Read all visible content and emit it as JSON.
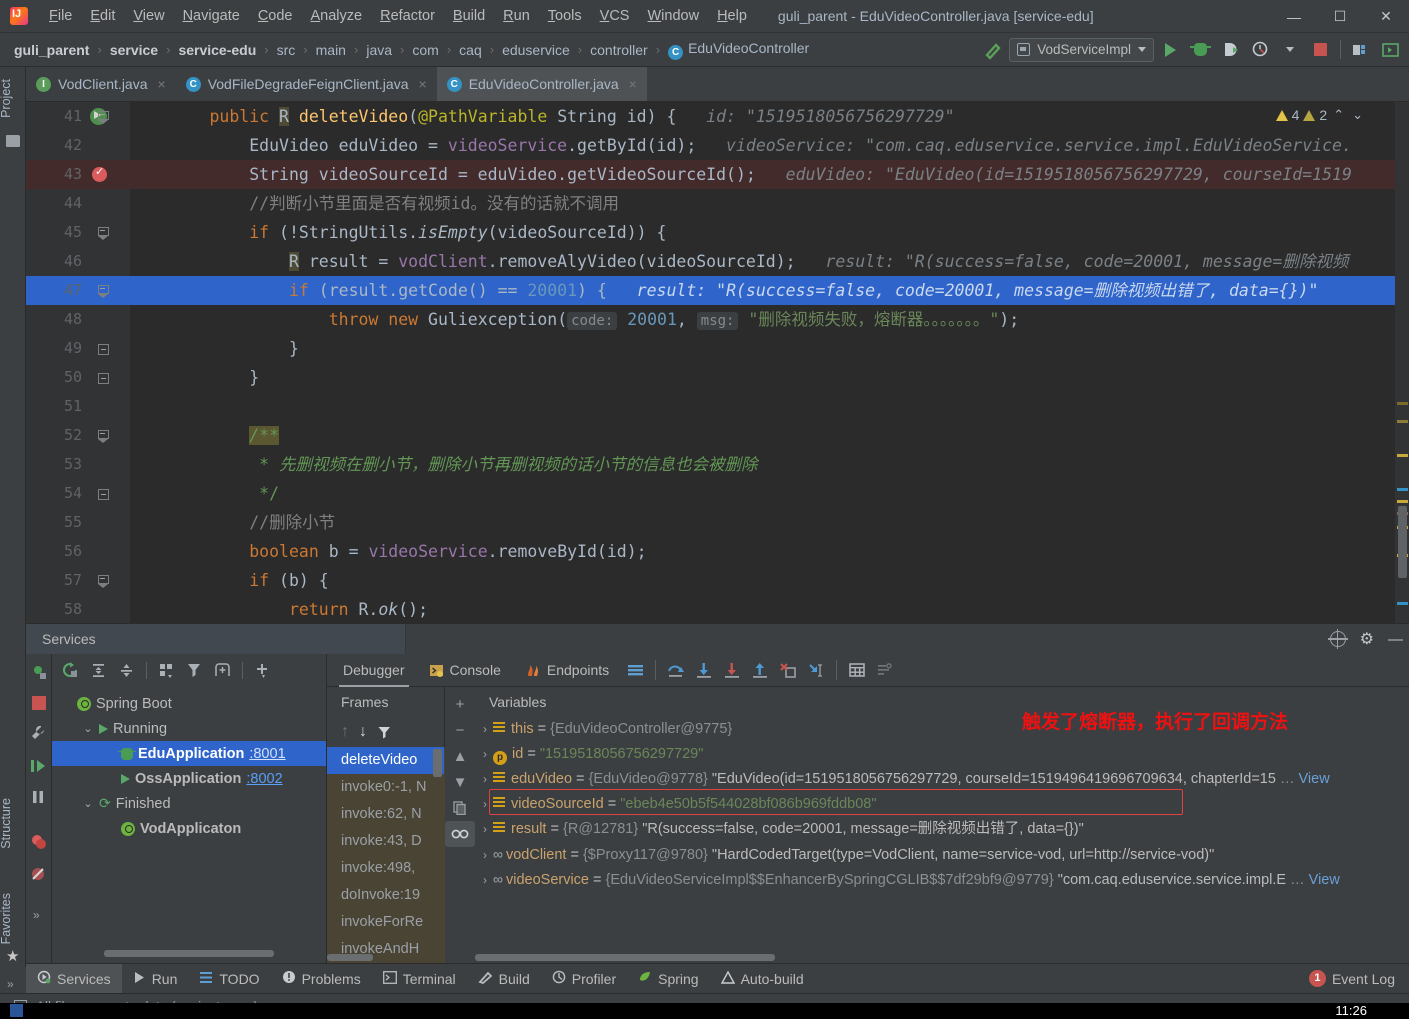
{
  "window": {
    "title": "guli_parent - EduVideoController.java [service-edu]",
    "minimize": "—",
    "maximize": "☐",
    "close": "✕"
  },
  "menu": [
    "File",
    "Edit",
    "View",
    "Navigate",
    "Code",
    "Analyze",
    "Refactor",
    "Build",
    "Run",
    "Tools",
    "VCS",
    "Window",
    "Help"
  ],
  "breadcrumb": {
    "items": [
      {
        "label": "guli_parent",
        "bold": true
      },
      {
        "label": "service",
        "bold": true
      },
      {
        "label": "service-edu",
        "bold": true
      },
      {
        "label": "src",
        "bold": false
      },
      {
        "label": "main",
        "bold": false
      },
      {
        "label": "java",
        "bold": false
      },
      {
        "label": "com",
        "bold": false
      },
      {
        "label": "caq",
        "bold": false
      },
      {
        "label": "eduservice",
        "bold": false
      },
      {
        "label": "controller",
        "bold": false
      },
      {
        "label": "EduVideoController",
        "bold": false,
        "icon": "C"
      }
    ],
    "separator": "›"
  },
  "toolbar": {
    "run_config": "VodServiceImpl",
    "icons": [
      "hammer-build-icon",
      "run-icon",
      "debug-icon",
      "run-with-coverage-icon",
      "profiler-icon",
      "stop-icon",
      "project-structure-icon",
      "search-everywhere-icon"
    ]
  },
  "tabs": [
    {
      "label": "VodClient.java",
      "icon": "I",
      "kind": "iface",
      "active": false
    },
    {
      "label": "VodFileDegradeFeignClient.java",
      "icon": "C",
      "kind": "cls",
      "active": false
    },
    {
      "label": "EduVideoController.java",
      "icon": "C",
      "kind": "cls",
      "active": true
    }
  ],
  "left_strip": {
    "project": "Project",
    "structure": "Structure",
    "favorites": "Favorites"
  },
  "editor": {
    "warnings": {
      "error_count": "4",
      "warn_count": "2",
      "up": "⌃",
      "down": "⌄"
    },
    "lines": [
      {
        "n": "41",
        "marker": "run",
        "fold": "collapse",
        "tokens": [
          {
            "t": "        ",
            "c": "pln"
          },
          {
            "t": "public",
            "c": "kw"
          },
          {
            "t": " ",
            "c": "pln"
          },
          {
            "t": "R",
            "c": "staticvar"
          },
          {
            "t": " ",
            "c": "pln"
          },
          {
            "t": "deleteVideo",
            "c": "fn"
          },
          {
            "t": "(",
            "c": "pln"
          },
          {
            "t": "@PathVariable",
            "c": "ann"
          },
          {
            "t": " String id) {",
            "c": "pln"
          }
        ],
        "hint": "id: \"1519518056756297729\""
      },
      {
        "n": "42",
        "marker": "",
        "fold": "",
        "tokens": [
          {
            "t": "            EduVideo eduVideo = ",
            "c": "pln"
          },
          {
            "t": "videoService",
            "c": "fld"
          },
          {
            "t": ".getById(id);",
            "c": "pln"
          }
        ],
        "hint": "videoService: \"com.caq.eduservice.service.impl.EduVideoService."
      },
      {
        "n": "43",
        "marker": "breakpoint",
        "fold": "",
        "hl": "red",
        "tokens": [
          {
            "t": "            String videoSourceId = eduVideo.getVideoSourceId();",
            "c": "pln"
          }
        ],
        "hint": "eduVideo: \"EduVideo(id=1519518056756297729, courseId=1519"
      },
      {
        "n": "44",
        "marker": "",
        "fold": "",
        "tokens": [
          {
            "t": "            //判断小节里面是否有视频id。没有的话就不调用",
            "c": "cmt"
          }
        ],
        "hint": ""
      },
      {
        "n": "45",
        "marker": "",
        "fold": "collapse",
        "tokens": [
          {
            "t": "            ",
            "c": "pln"
          },
          {
            "t": "if",
            "c": "kw"
          },
          {
            "t": " (!StringUtils.",
            "c": "pln"
          },
          {
            "t": "isEmpty",
            "c": "pln ital"
          },
          {
            "t": "(videoSourceId)) {",
            "c": "pln"
          }
        ],
        "hint": ""
      },
      {
        "n": "46",
        "marker": "",
        "fold": "",
        "tokens": [
          {
            "t": "                ",
            "c": "pln"
          },
          {
            "t": "R",
            "c": "staticvar"
          },
          {
            "t": " result = ",
            "c": "pln"
          },
          {
            "t": "vodClient",
            "c": "fld"
          },
          {
            "t": ".removeAlyVideo(videoSourceId);",
            "c": "pln"
          }
        ],
        "hint": "result: \"R(success=false, code=20001, message=删除视频"
      },
      {
        "n": "47",
        "marker": "",
        "fold": "collapse",
        "hl": "blue",
        "tokens": [
          {
            "t": "                ",
            "c": "pln"
          },
          {
            "t": "if",
            "c": "kw"
          },
          {
            "t": " (result.getCode() == ",
            "c": "pln"
          },
          {
            "t": "20001",
            "c": "num"
          },
          {
            "t": ") {",
            "c": "pln"
          }
        ],
        "hint": "result: \"R(success=false, code=20001, message=删除视频出错了, data={})\""
      },
      {
        "n": "48",
        "marker": "",
        "fold": "",
        "tokens": [
          {
            "t": "                    ",
            "c": "pln"
          },
          {
            "t": "throw",
            "c": "kw"
          },
          {
            "t": " ",
            "c": "pln"
          },
          {
            "t": "new",
            "c": "kw"
          },
          {
            "t": " ",
            "c": "pln"
          },
          {
            "t": "Guliexception",
            "c": "pln"
          },
          {
            "t": "(",
            "c": "pln"
          },
          {
            "t": "code:",
            "c": "param"
          },
          {
            "t": " ",
            "c": "pln"
          },
          {
            "t": "20001",
            "c": "num"
          },
          {
            "t": ", ",
            "c": "pln"
          },
          {
            "t": "msg:",
            "c": "param"
          },
          {
            "t": " ",
            "c": "pln"
          },
          {
            "t": "\"删除视频失败，熔断器。。。。。。。\"",
            "c": "str"
          },
          {
            "t": ");",
            "c": "pln"
          }
        ],
        "hint": ""
      },
      {
        "n": "49",
        "marker": "",
        "fold": "marker",
        "tokens": [
          {
            "t": "                }",
            "c": "pln"
          }
        ],
        "hint": ""
      },
      {
        "n": "50",
        "marker": "",
        "fold": "marker",
        "tokens": [
          {
            "t": "            }",
            "c": "pln"
          }
        ],
        "hint": ""
      },
      {
        "n": "51",
        "marker": "",
        "fold": "",
        "tokens": [
          {
            "t": "",
            "c": "pln"
          }
        ],
        "hint": ""
      },
      {
        "n": "52",
        "marker": "",
        "fold": "collapse",
        "tokens": [
          {
            "t": "            ",
            "c": "pln"
          },
          {
            "t": "/**",
            "c": "docstart"
          }
        ],
        "hint": ""
      },
      {
        "n": "53",
        "marker": "",
        "fold": "",
        "tokens": [
          {
            "t": "             ",
            "c": "pln"
          },
          {
            "t": "*",
            "c": "doctag"
          },
          {
            "t": " 先删视频在删小节，删除小节再删视频的话小节的信息也会被删除",
            "c": "doc"
          }
        ],
        "hint": ""
      },
      {
        "n": "54",
        "marker": "",
        "fold": "marker",
        "tokens": [
          {
            "t": "             ",
            "c": "pln"
          },
          {
            "t": "*/",
            "c": "doctag"
          }
        ],
        "hint": ""
      },
      {
        "n": "55",
        "marker": "",
        "fold": "",
        "tokens": [
          {
            "t": "            //删除小节",
            "c": "cmt"
          }
        ],
        "hint": ""
      },
      {
        "n": "56",
        "marker": "",
        "fold": "",
        "tokens": [
          {
            "t": "            ",
            "c": "pln"
          },
          {
            "t": "boolean",
            "c": "kw"
          },
          {
            "t": " b = ",
            "c": "pln"
          },
          {
            "t": "videoService",
            "c": "fld"
          },
          {
            "t": ".removeById(id);",
            "c": "pln"
          }
        ],
        "hint": ""
      },
      {
        "n": "57",
        "marker": "",
        "fold": "collapse",
        "tokens": [
          {
            "t": "            ",
            "c": "pln"
          },
          {
            "t": "if",
            "c": "kw"
          },
          {
            "t": " (b) {",
            "c": "pln"
          }
        ],
        "hint": ""
      },
      {
        "n": "58",
        "marker": "",
        "fold": "",
        "tokens": [
          {
            "t": "                ",
            "c": "pln"
          },
          {
            "t": "return",
            "c": "kw"
          },
          {
            "t": " R.",
            "c": "pln"
          },
          {
            "t": "ok",
            "c": "pln ital"
          },
          {
            "t": "();",
            "c": "pln"
          }
        ],
        "hint": ""
      }
    ]
  },
  "services": {
    "panel_title": "Services",
    "header_icons": [
      "target-icon",
      "gear-icon",
      "minimize-icon"
    ],
    "tree_toolbar": [
      "rerun-icon",
      "expand-all-icon",
      "collapse-all-icon",
      "group-icon",
      "filter-icon",
      "add-tab-icon",
      "add-icon"
    ],
    "tree": [
      {
        "label": "Spring Boot",
        "indent": 0,
        "twist": "",
        "icon": "spring-icon",
        "bold": false,
        "port": "",
        "selected": false
      },
      {
        "label": "Running",
        "indent": 1,
        "twist": "⌄",
        "icon": "run-icon",
        "bold": false,
        "port": "",
        "selected": false
      },
      {
        "label": "EduApplication",
        "indent": 2,
        "twist": "",
        "icon": "debug-icon",
        "bold": true,
        "port": ":8001",
        "selected": true
      },
      {
        "label": "OssApplication",
        "indent": 2,
        "twist": "",
        "icon": "run-icon",
        "bold": true,
        "port": ":8002",
        "selected": false
      },
      {
        "label": "Finished",
        "indent": 1,
        "twist": "⌄",
        "icon": "rerun-icon",
        "bold": false,
        "port": "",
        "selected": false
      },
      {
        "label": "VodApplicaton",
        "indent": 2,
        "twist": "",
        "icon": "spring-icon",
        "bold": true,
        "port": "",
        "selected": false
      }
    ],
    "debugger_tabs": [
      {
        "label": "Debugger",
        "icon": "",
        "active": true
      },
      {
        "label": "Console",
        "icon": "console-icon",
        "active": false
      },
      {
        "label": "Endpoints",
        "icon": "endpoints-icon",
        "active": false
      }
    ],
    "debugger_toolbar": [
      "layout-icon",
      "step-over-icon",
      "step-into-icon",
      "force-step-into-icon",
      "step-out-icon",
      "drop-frame-icon",
      "run-to-cursor-icon",
      "evaluate-icon",
      "settings-icon"
    ],
    "frames": {
      "title": "Frames",
      "toolbar": [
        "up-icon",
        "down-icon",
        "filter-icon"
      ],
      "rows": [
        {
          "label": "deleteVideo",
          "selected": true
        },
        {
          "label": "invoke0:-1, N",
          "selected": false
        },
        {
          "label": "invoke:62, N",
          "selected": false
        },
        {
          "label": "invoke:43, D",
          "selected": false
        },
        {
          "label": "invoke:498, ",
          "selected": false
        },
        {
          "label": "doInvoke:19",
          "selected": false
        },
        {
          "label": "invokeForRe",
          "selected": false
        },
        {
          "label": "invokeAndH",
          "selected": false
        }
      ]
    },
    "variables": {
      "title": "Variables",
      "tools": [
        "add-icon",
        "remove-icon",
        "up-icon",
        "down-icon",
        "copy-icon",
        "watches-icon"
      ],
      "annotation": "触发了熔断器，执行了回调方法",
      "rows": [
        {
          "arrow": "›",
          "icon": "field-icon",
          "name": "this",
          "eq": " = ",
          "ref": "{EduVideoController@9775}",
          "value": "",
          "view": "",
          "highlight": false
        },
        {
          "arrow": "›",
          "icon": "param-icon",
          "name": "id",
          "eq": " = ",
          "ref": "",
          "value": "\"1519518056756297729\"",
          "view": "",
          "highlight": false
        },
        {
          "arrow": "›",
          "icon": "field-icon",
          "name": "eduVideo",
          "eq": " = ",
          "ref": "{EduVideo@9778}",
          "value": "\"EduVideo(id=1519518056756297729, courseId=1519496419696709634, chapterId=15",
          "ellipsis": "…",
          "view": "View",
          "highlight": false
        },
        {
          "arrow": "›",
          "icon": "field-icon",
          "name": "videoSourceId",
          "eq": " = ",
          "ref": "",
          "value": "\"ebeb4e50b5f544028bf086b969fddb08\"",
          "view": "",
          "highlight": false
        },
        {
          "arrow": "›",
          "icon": "field-icon",
          "name": "result",
          "eq": " = ",
          "ref": "{R@12781}",
          "value": "\"R(success=false, code=20001, message=删除视频出错了, data={})\"",
          "view": "",
          "highlight": true
        },
        {
          "arrow": "›",
          "icon": "ref-icon",
          "name": "vodClient",
          "eq": " = ",
          "ref": "{$Proxy117@9780}",
          "value": "\"HardCodedTarget(type=VodClient, name=service-vod, url=http://service-vod)\"",
          "view": "",
          "highlight": false
        },
        {
          "arrow": "›",
          "icon": "ref-icon",
          "name": "videoService",
          "eq": " = ",
          "ref": "{EduVideoServiceImpl$$EnhancerBySpringCGLIB$$7df29bf9@9779}",
          "value": "\"com.caq.eduservice.service.impl.E",
          "ellipsis": "…",
          "view": "View",
          "highlight": false
        }
      ]
    }
  },
  "bottom_bar": {
    "items": [
      {
        "label": "Services",
        "icon": "services-icon",
        "active": true
      },
      {
        "label": "Run",
        "icon": "run-icon",
        "active": false
      },
      {
        "label": "TODO",
        "icon": "todo-icon",
        "active": false
      },
      {
        "label": "Problems",
        "icon": "problems-icon",
        "active": false
      },
      {
        "label": "Terminal",
        "icon": "terminal-icon",
        "active": false
      },
      {
        "label": "Build",
        "icon": "build-icon",
        "active": false
      },
      {
        "label": "Profiler",
        "icon": "profiler-icon",
        "active": false
      },
      {
        "label": "Spring",
        "icon": "spring-icon",
        "active": false
      },
      {
        "label": "Auto-build",
        "icon": "warning-icon",
        "active": false
      }
    ],
    "event_log": {
      "label": "Event Log",
      "badge": "1"
    }
  },
  "status_bar": {
    "message": "All files are up-to-date (a minute ago)"
  },
  "taskbar": {
    "clock": "11:26"
  }
}
